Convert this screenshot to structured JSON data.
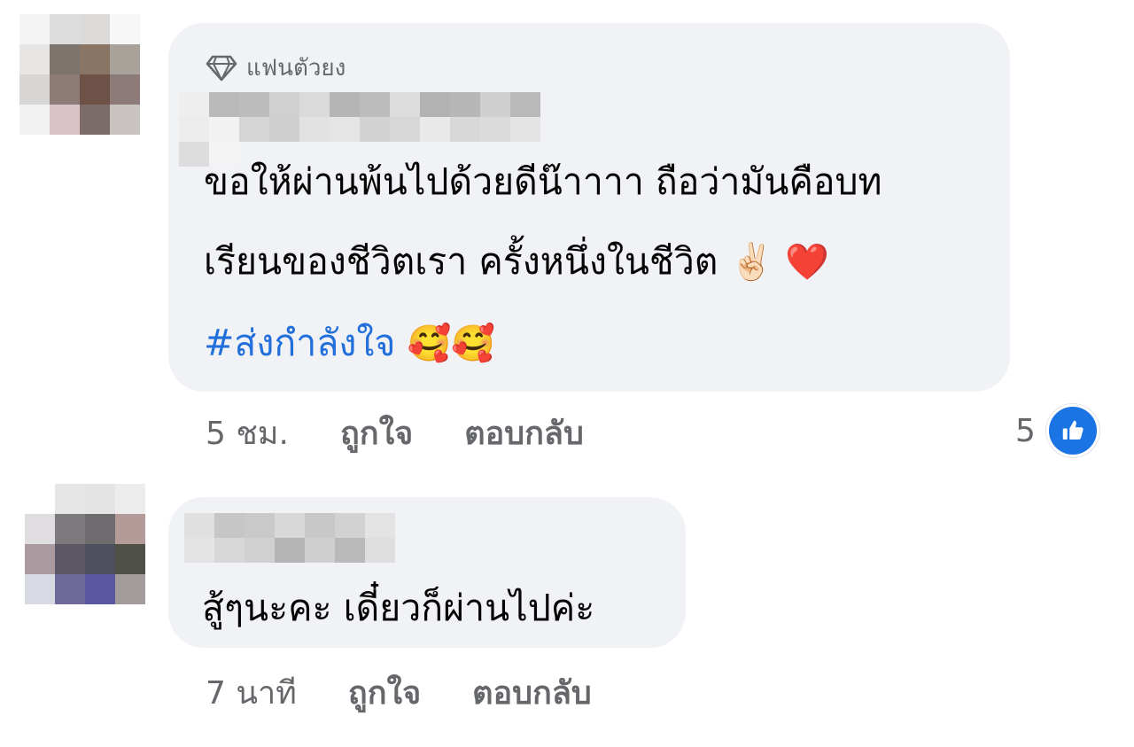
{
  "comments": [
    {
      "badge": "แฟนตัวยง",
      "text_line1": "ขอให้ผ่านพ้นไปด้วยดีน๊าาาา ถือว่ามันคือบท",
      "text_line2": "เรียนของชีวิตเรา ครั้งหนึ่งในชีวิต",
      "text_line2_emojis": "✌🏻 ❤️",
      "hashtag": "#ส่งกำลังใจ",
      "hashtag_emojis": "🥰🥰",
      "timestamp": "5 ชม.",
      "like_label": "ถูกใจ",
      "reply_label": "ตอบกลับ",
      "reaction_count": "5",
      "reaction_icon": "like-thumb-icon"
    },
    {
      "text": "สู้ๆนะคะ เดี๋ยวก็ผ่านไปค่ะ",
      "timestamp": "7 นาที",
      "like_label": "ถูกใจ",
      "reply_label": "ตอบกลับ"
    }
  ],
  "colors": {
    "bubble": "#f0f2f5",
    "hashtag": "#216fdb",
    "meta_text": "#65676b",
    "like_blue": "#1b74e4"
  }
}
